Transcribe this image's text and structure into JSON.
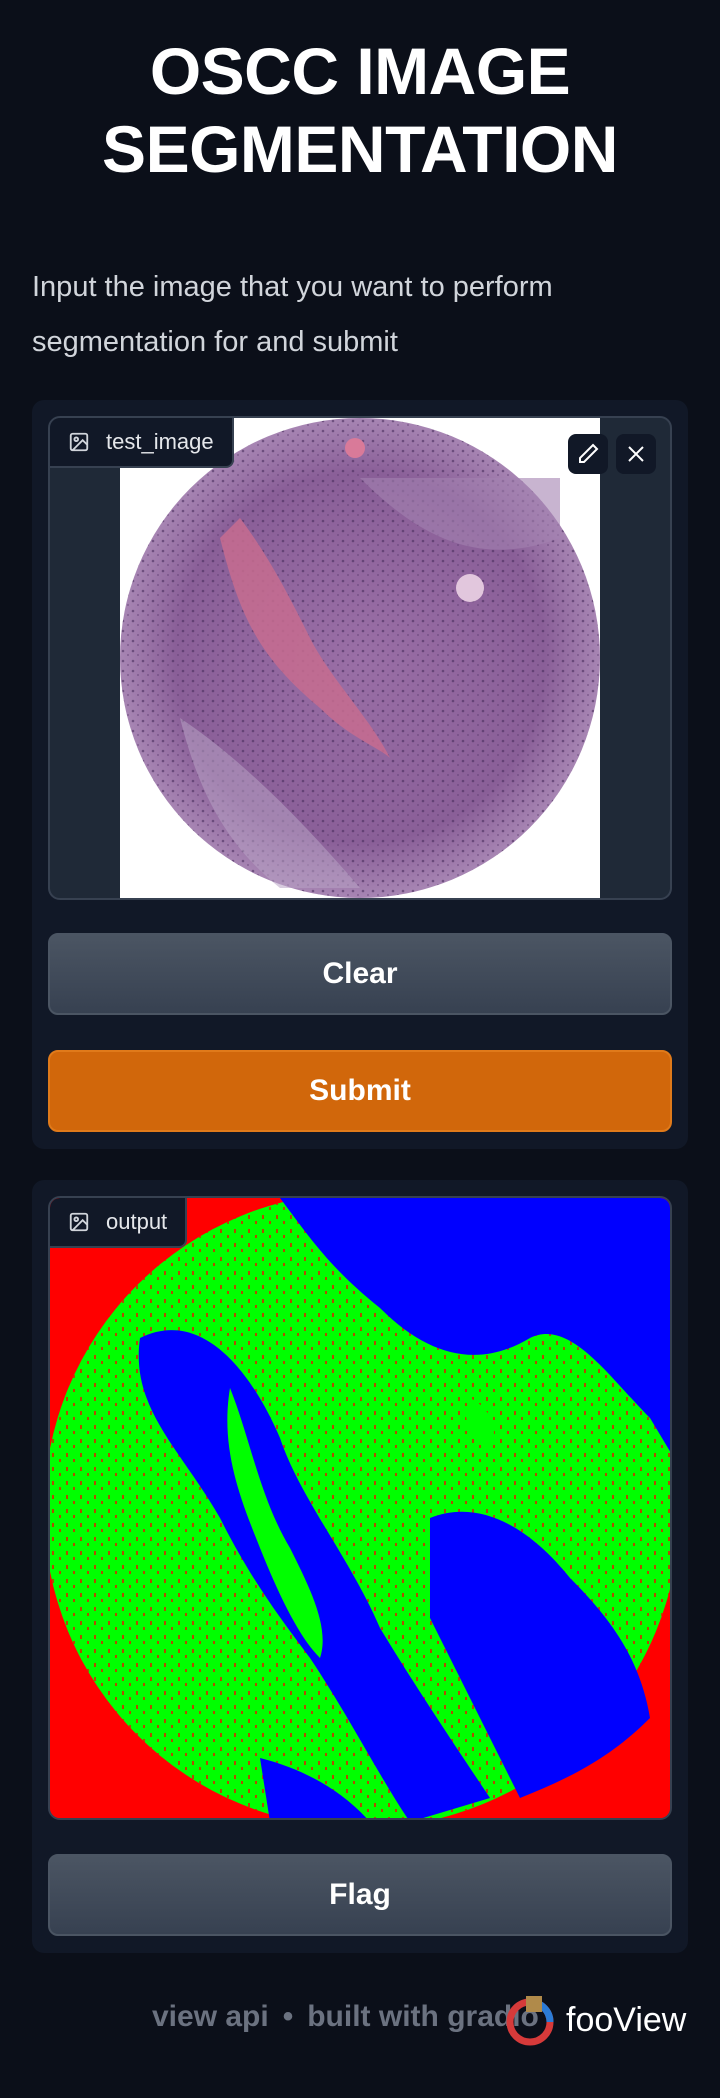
{
  "page": {
    "title_line1": "OSCC IMAGE",
    "title_line2": "SEGMENTATION",
    "description": "Input the image that you want to perform segmentation for and submit"
  },
  "input_panel": {
    "image_label": "test_image",
    "edit_icon": "pencil-icon",
    "close_icon": "close-icon",
    "clear_label": "Clear",
    "submit_label": "Submit"
  },
  "output_panel": {
    "image_label": "output",
    "flag_label": "Flag"
  },
  "footer": {
    "view_api": "view api",
    "separator": "•",
    "built_with": "built with gradio",
    "watermark": "fooView"
  },
  "colors": {
    "background": "#0b0f19",
    "panel": "#111827",
    "primary_button": "#d1670b",
    "segment_red": "#ff0000",
    "segment_green": "#00ff00",
    "segment_blue": "#0000ff"
  }
}
